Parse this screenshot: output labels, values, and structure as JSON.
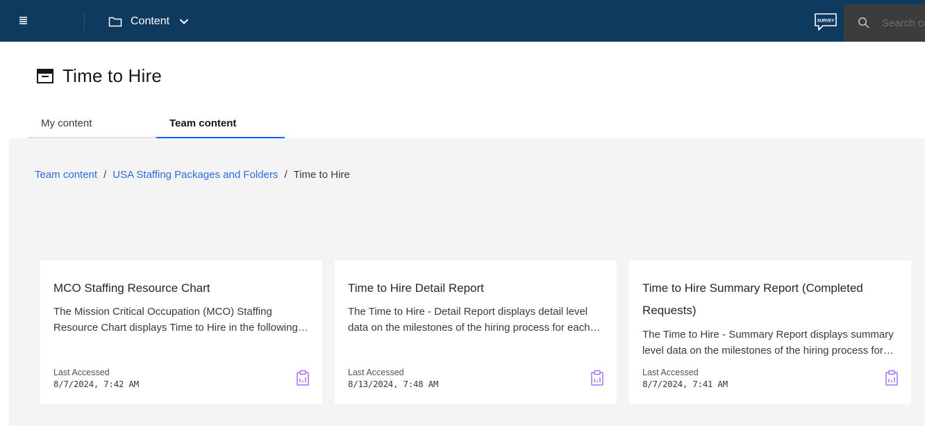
{
  "topbar": {
    "menu_icon": "hamburger-menu-icon",
    "content_menu_label": "Content",
    "content_menu_icon": "folder-icon",
    "content_menu_chevron": "chevron-down-icon",
    "survey_label": "SURVEY",
    "search_icon": "search-icon",
    "search_placeholder": "Search content",
    "bar_color": "#0f3a5f"
  },
  "page": {
    "title": "Time to Hire",
    "title_icon": "package-icon"
  },
  "tabs": [
    {
      "label": "My content",
      "active": false
    },
    {
      "label": "Team content",
      "active": true
    }
  ],
  "breadcrumb": {
    "items": [
      "Team content",
      "USA Staffing Packages and Folders"
    ],
    "current": "Time to Hire",
    "link_color": "#2d6ad8"
  },
  "cards": [
    {
      "title": "MCO Staffing Resource Chart",
      "description": "The Mission Critical Occupation (MCO) Staffing Resource Chart displays Time to Hire in the following format for each occupation across all agencies.",
      "last_accessed_label": "Last Accessed",
      "last_accessed": "8/7/2024, 7:42 AM",
      "icon": "report-icon"
    },
    {
      "title": "Time to Hire Detail Report",
      "description": "The Time to Hire - Detail Report displays detail level data on the milestones of the hiring process for each request.",
      "last_accessed_label": "Last Accessed",
      "last_accessed": "8/13/2024, 7:48 AM",
      "icon": "report-icon"
    },
    {
      "title": "Time to Hire Summary Report (Completed Requests)",
      "description": "The Time to Hire - Summary Report displays summary level data on the milestones of the hiring process for completed requests.",
      "last_accessed_label": "Last Accessed",
      "last_accessed": "8/7/2024, 7:41 AM",
      "icon": "report-icon"
    }
  ],
  "accent_color": "#0f62fe",
  "report_icon_color": "#a56eff"
}
